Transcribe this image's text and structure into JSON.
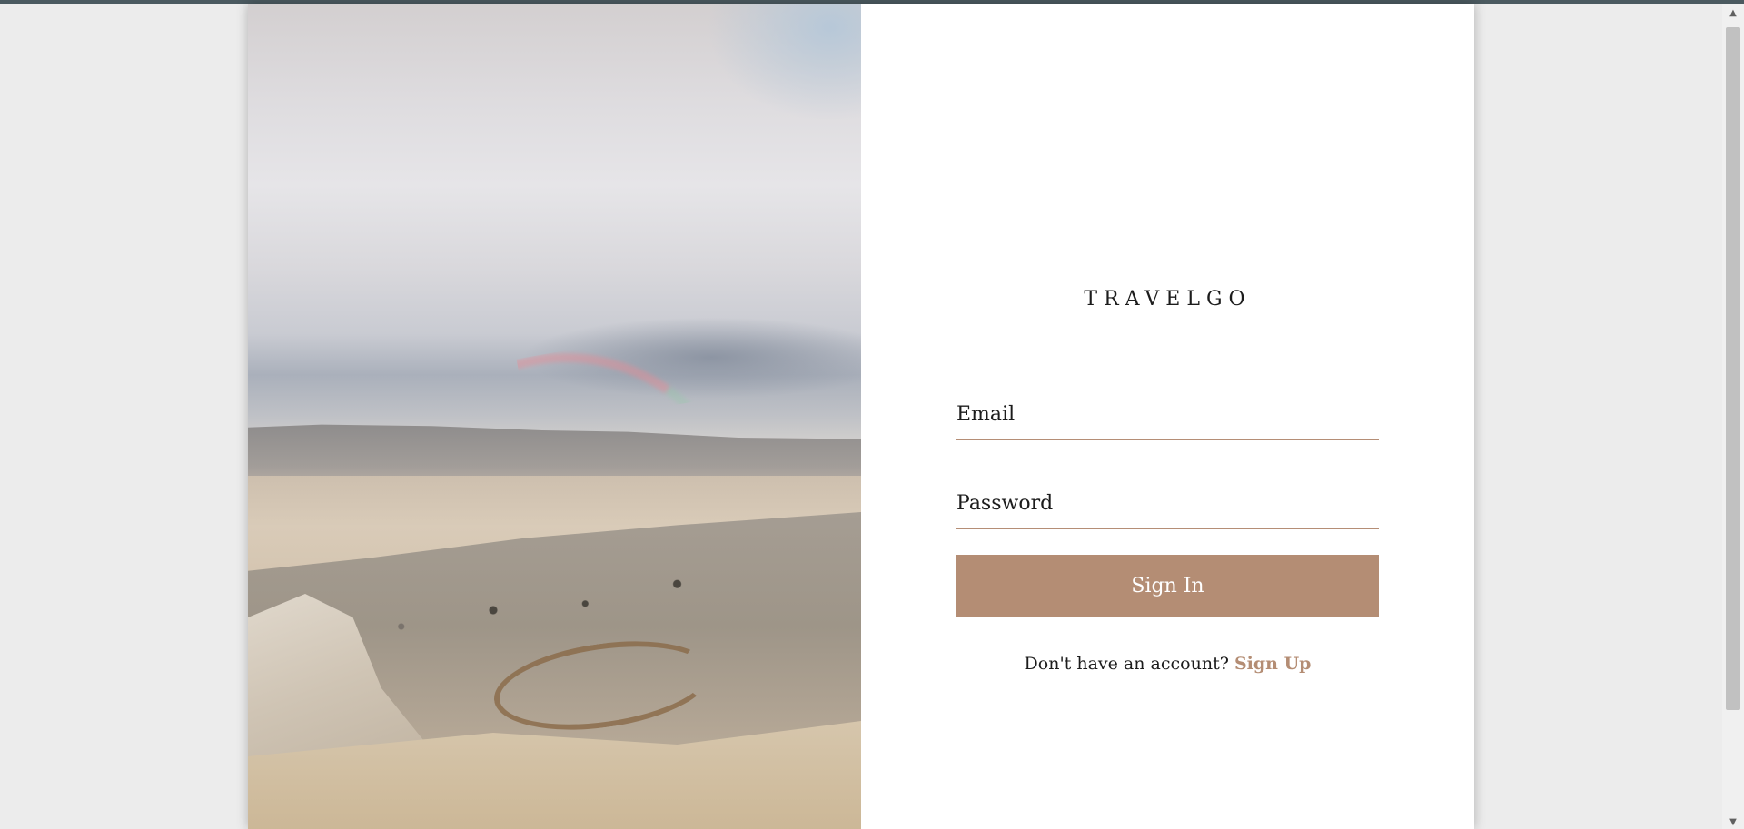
{
  "brand": {
    "name": "TRAVELGO"
  },
  "form": {
    "email_placeholder": "Email",
    "password_placeholder": "Password",
    "signin_label": "Sign In",
    "signup_prompt": "Don't have an account?",
    "signup_link": "Sign Up"
  },
  "colors": {
    "accent": "#b48d74",
    "background": "#ececec",
    "card": "#ffffff"
  },
  "scrollbar": {
    "up_arrow": "▲",
    "down_arrow": "▼"
  }
}
